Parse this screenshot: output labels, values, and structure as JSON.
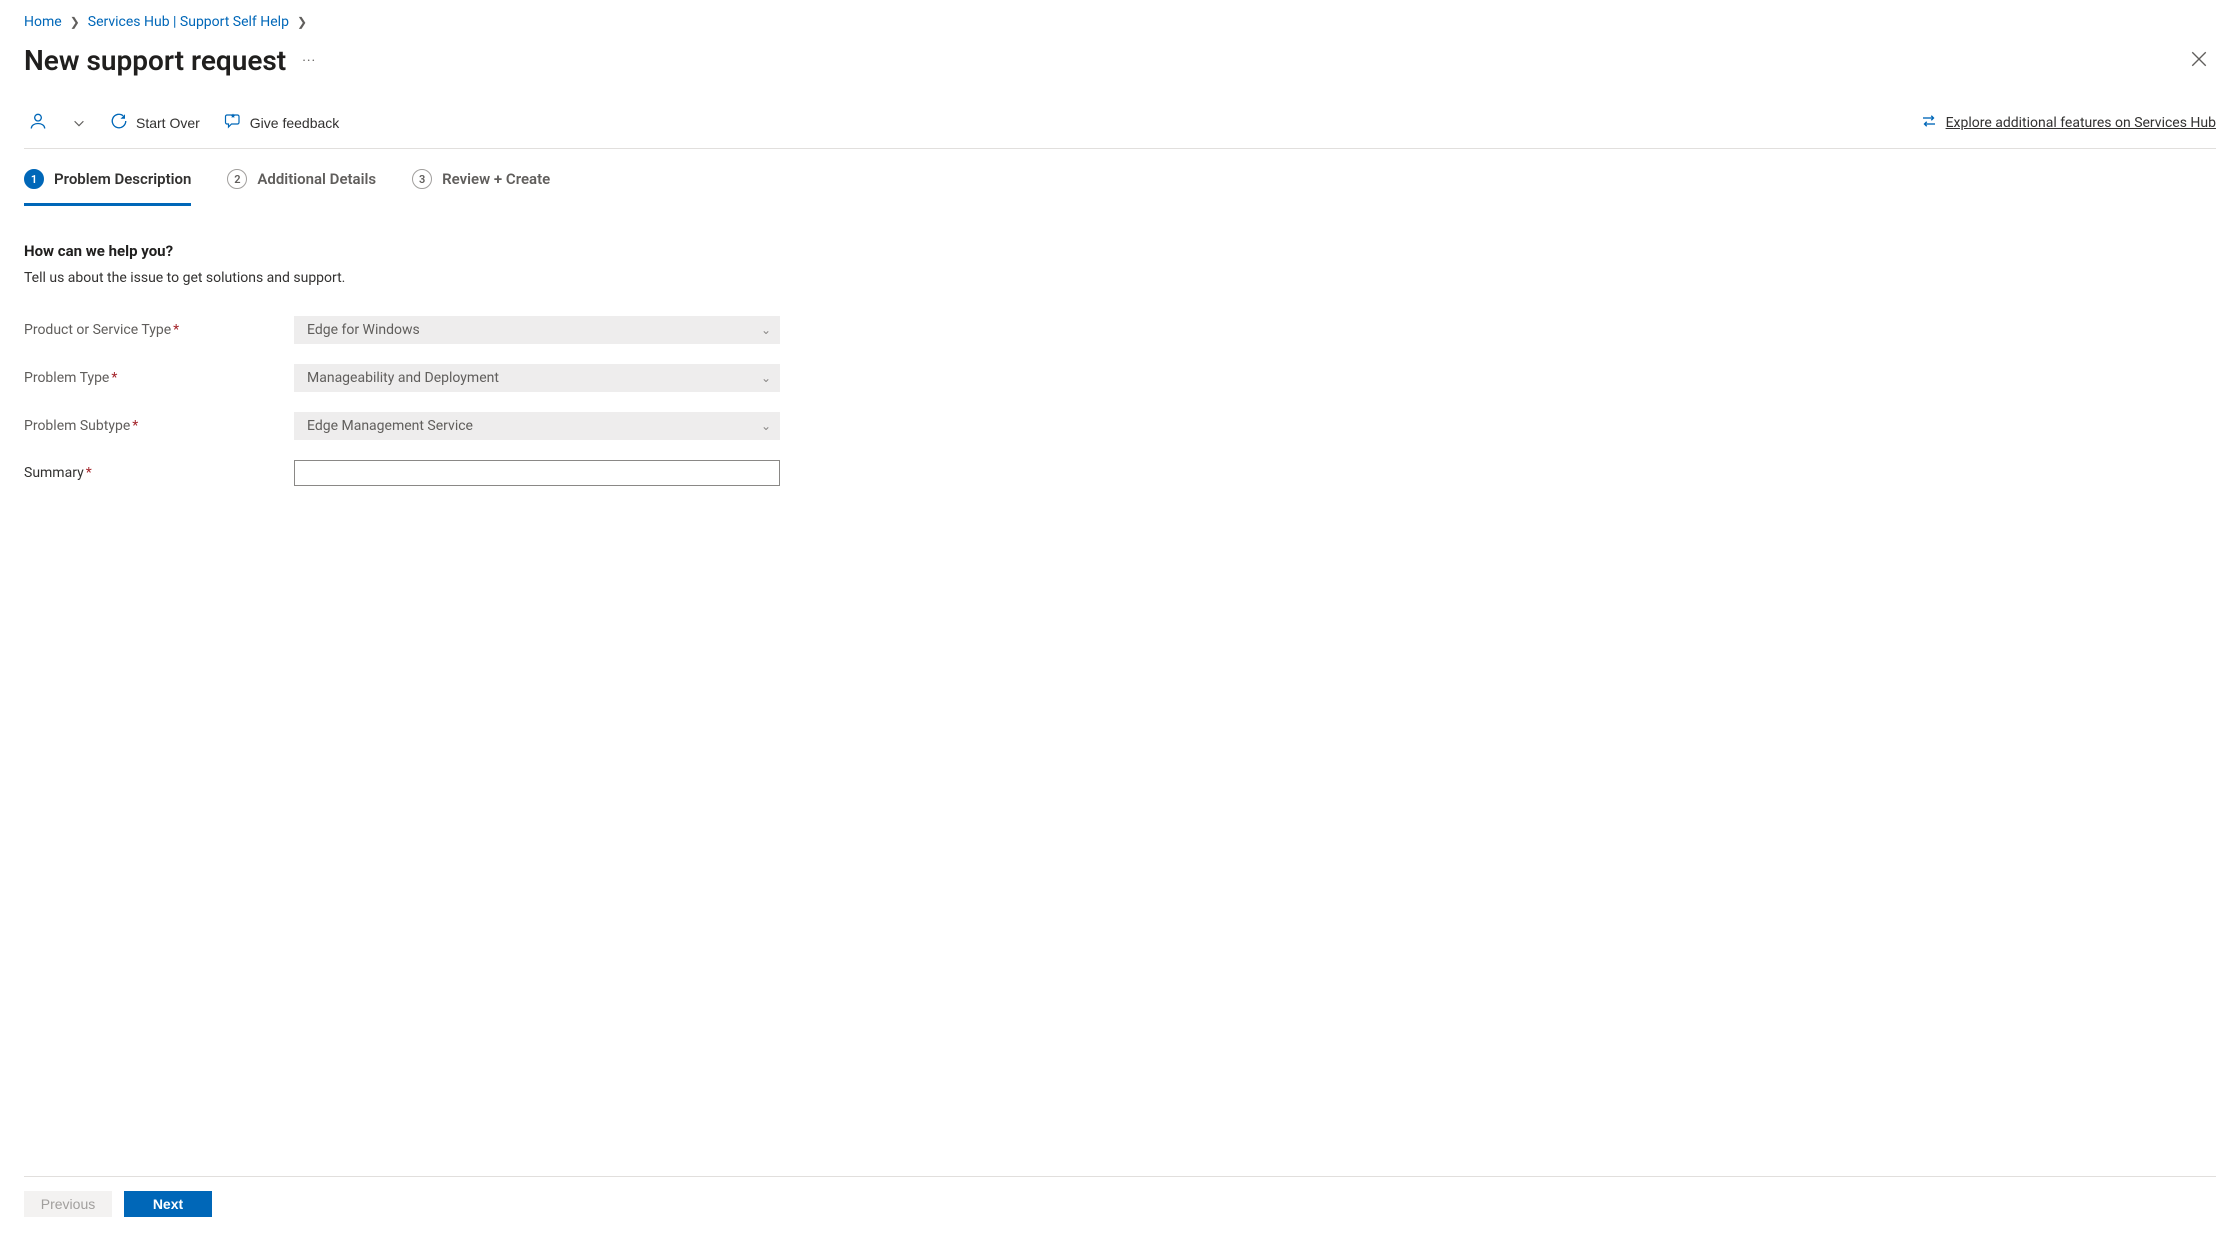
{
  "breadcrumb": {
    "home": "Home",
    "services_hub": "Services Hub | Support Self Help"
  },
  "page": {
    "title": "New support request"
  },
  "toolbar": {
    "start_over": "Start Over",
    "give_feedback": "Give feedback",
    "explore_link": "Explore additional features on Services Hub"
  },
  "steps": {
    "s1": {
      "num": "1",
      "label": "Problem Description"
    },
    "s2": {
      "num": "2",
      "label": "Additional Details"
    },
    "s3": {
      "num": "3",
      "label": "Review + Create"
    }
  },
  "form": {
    "heading": "How can we help you?",
    "subtitle": "Tell us about the issue to get solutions and support.",
    "product_label": "Product or Service Type",
    "product_value": "Edge for Windows",
    "problem_type_label": "Problem Type",
    "problem_type_value": "Manageability and Deployment",
    "problem_subtype_label": "Problem Subtype",
    "problem_subtype_value": "Edge Management Service",
    "summary_label": "Summary",
    "summary_value": ""
  },
  "footer": {
    "previous": "Previous",
    "next": "Next"
  }
}
